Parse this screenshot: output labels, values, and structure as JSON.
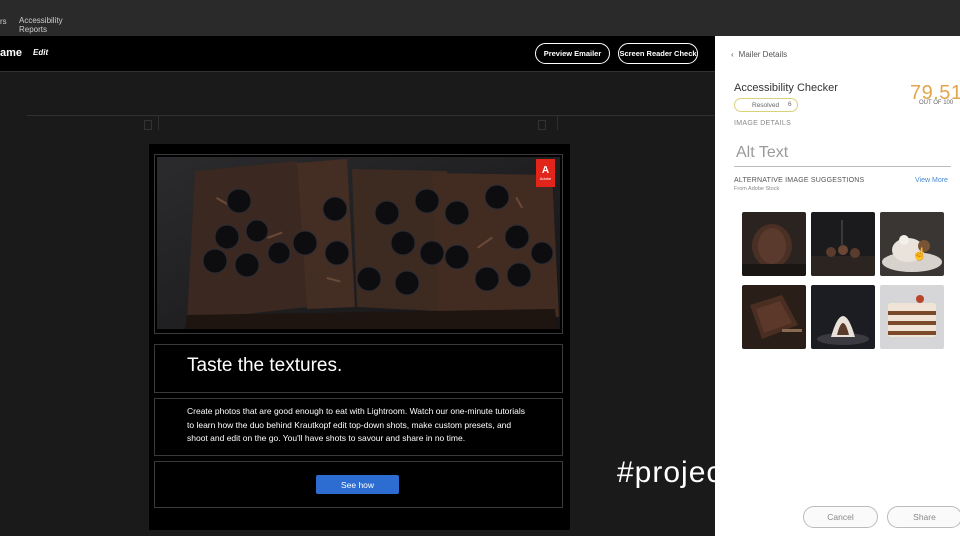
{
  "topnav": {
    "fragment": "rs",
    "reports_label": "Accessibility Reports"
  },
  "header": {
    "doc_name": "ame",
    "edit_label": "Edit",
    "preview_button": "Preview Emailer",
    "screen_reader_button": "Screen Reader Check"
  },
  "email": {
    "hero_badge": "Adobe",
    "headline": "Taste the textures.",
    "body": "Create photos that are good enough to eat with Lightroom. Watch our one-minute tutorials to learn how the duo behind Krautkopf edit top-down shots, make custom presets, and shoot and edit on the go. You'll have shots to savour and share in no time.",
    "cta_label": "See how"
  },
  "overlay": {
    "hashtag": "#projectaccessace"
  },
  "panel": {
    "back_label": "Mailer Details",
    "checker_title": "Accessibility Checker",
    "score": "79.51",
    "score_label": "OUT OF 100",
    "resolved_label": "Resolved",
    "resolved_count": "6",
    "image_details_label": "IMAGE DETAILS",
    "alt_text_placeholder": "Alt Text",
    "suggestions_title": "ALTERNATIVE IMAGE SUGGESTIONS",
    "suggestions_source": "From Adobe Stock",
    "view_more": "View More",
    "thumbnails": [
      "chocolate-cookie-stack",
      "cake-pops-dark",
      "plated-dessert",
      "brownie-slices",
      "meringue-chocolate",
      "layer-cake"
    ],
    "cancel_label": "Cancel",
    "share_label": "Share"
  },
  "colors": {
    "accent_blue": "#2d6dd2",
    "score_gold": "#e2a64a",
    "adobe_red": "#e1251b"
  }
}
